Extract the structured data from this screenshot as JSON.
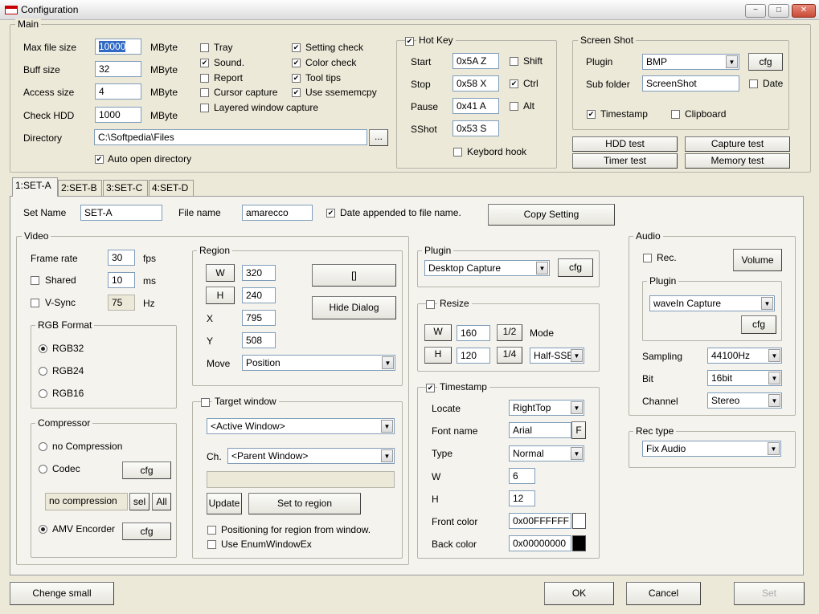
{
  "window": {
    "title": "Configuration",
    "min": "−",
    "max": "□",
    "close": "✕"
  },
  "main": {
    "legend": "Main",
    "maxfile": {
      "label": "Max file size",
      "value": "10000",
      "unit": "MByte"
    },
    "buff": {
      "label": "Buff size",
      "value": "32",
      "unit": "MByte"
    },
    "access": {
      "label": "Access size",
      "value": "4",
      "unit": "MByte"
    },
    "checkhdd": {
      "label": "Check HDD",
      "value": "1000",
      "unit": "MByte"
    },
    "directory": {
      "label": "Directory",
      "value": "C:\\Softpedia\\Files",
      "browse": "..."
    },
    "autoopen": "Auto open directory",
    "tray": "Tray",
    "sound": "Sound.",
    "report": "Report",
    "cursor": "Cursor capture",
    "layered": "Layered window capture",
    "settingcheck": "Setting check",
    "colorcheck": "Color check",
    "tooltips": "Tool tips",
    "ssememcpy": "Use ssememcpy"
  },
  "hotkey": {
    "legend": "Hot Key",
    "start": {
      "label": "Start",
      "value": "0x5A Z"
    },
    "stop": {
      "label": "Stop",
      "value": "0x58 X"
    },
    "pause": {
      "label": "Pause",
      "value": "0x41 A"
    },
    "sshot": {
      "label": "SShot",
      "value": "0x53 S"
    },
    "shift": "Shift",
    "ctrl": "Ctrl",
    "alt": "Alt",
    "keybord": "Keybord hook"
  },
  "screenshot": {
    "legend": "Screen Shot",
    "plugin_label": "Plugin",
    "plugin_value": "BMP",
    "cfg": "cfg",
    "subfolder_label": "Sub folder",
    "subfolder_value": "ScreenShot",
    "date": "Date",
    "timestamp": "Timestamp",
    "clipboard": "Clipboard"
  },
  "tests": {
    "hdd": "HDD test",
    "capture": "Capture test",
    "timer": "Timer test",
    "memory": "Memory test"
  },
  "tabs": [
    "1:SET-A",
    "2:SET-B",
    "3:SET-C",
    "4:SET-D"
  ],
  "set": {
    "name_label": "Set Name",
    "name_value": "SET-A",
    "file_label": "File name",
    "file_value": "amarecco",
    "date_appended": "Date appended to file name.",
    "copy": "Copy Setting"
  },
  "video": {
    "legend": "Video",
    "framerate": {
      "label": "Frame rate",
      "value": "30",
      "unit": "fps"
    },
    "shared": {
      "label": "Shared",
      "value": "10",
      "unit": "ms"
    },
    "vsync": {
      "label": "V-Sync",
      "value": "75",
      "unit": "Hz"
    },
    "rgb_legend": "RGB Format",
    "rgb32": "RGB32",
    "rgb24": "RGB24",
    "rgb16": "RGB16",
    "comp_legend": "Compressor",
    "nocomp": "no Compression",
    "codec": "Codec",
    "cfg": "cfg",
    "comp_value": "no compression",
    "sel": "sel",
    "all": "All",
    "amv": "AMV Encorder"
  },
  "region": {
    "legend": "Region",
    "w_btn": "W",
    "w_value": "320",
    "h_btn": "H",
    "h_value": "240",
    "x_label": "X",
    "x_value": "795",
    "y_label": "Y",
    "y_value": "508",
    "move_label": "Move",
    "move_value": "Position",
    "bracket": "[]",
    "hide": "Hide Dialog"
  },
  "target": {
    "legend": "Target window",
    "active": "<Active Window>",
    "ch_label": "Ch.",
    "ch_value": "<Parent Window>",
    "update": "Update",
    "settoregion": "Set to region",
    "positioning": "Positioning for region from window.",
    "enumex": "Use EnumWindowEx"
  },
  "plugin": {
    "legend": "Plugin",
    "value": "Desktop Capture",
    "cfg": "cfg"
  },
  "resize": {
    "legend": "Resize",
    "w_btn": "W",
    "w_value": "160",
    "half": "1/2",
    "mode_label": "Mode",
    "h_btn": "H",
    "h_value": "120",
    "quarter": "1/4",
    "mode_value": "Half-SSE"
  },
  "timestamp": {
    "legend": "Timestamp",
    "locate_label": "Locate",
    "locate_value": "RightTop",
    "font_label": "Font name",
    "font_value": "Arial",
    "font_btn": "F",
    "type_label": "Type",
    "type_value": "Normal",
    "w_label": "W",
    "w_value": "6",
    "h_label": "H",
    "h_value": "12",
    "front_label": "Front color",
    "front_value": "0x00FFFFFF",
    "back_label": "Back color",
    "back_value": "0x00000000",
    "front_color": "#ffffff",
    "back_color": "#000000"
  },
  "audio": {
    "legend": "Audio",
    "rec": "Rec.",
    "volume": "Volume",
    "plugin_legend": "Plugin",
    "plugin_value": "waveIn Capture",
    "cfg": "cfg",
    "sampling_label": "Sampling",
    "sampling_value": "44100Hz",
    "bit_label": "Bit",
    "bit_value": "16bit",
    "channel_label": "Channel",
    "channel_value": "Stereo"
  },
  "rectype": {
    "legend": "Rec type",
    "value": "Fix Audio"
  },
  "footer": {
    "change": "Chenge small",
    "ok": "OK",
    "cancel": "Cancel",
    "set": "Set"
  }
}
